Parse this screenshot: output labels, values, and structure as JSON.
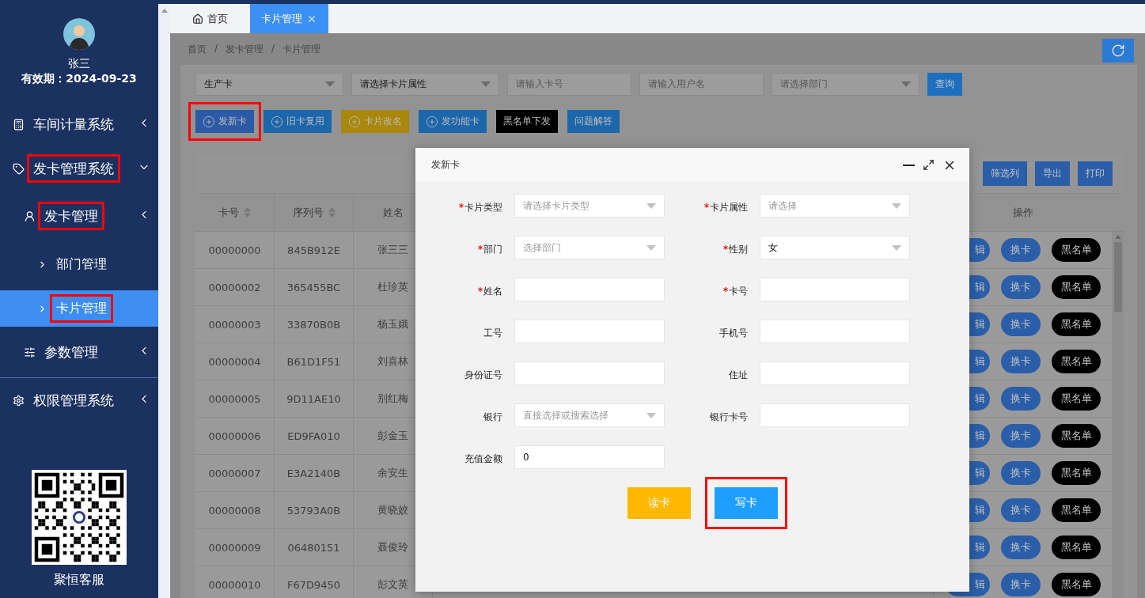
{
  "sidebar": {
    "user": {
      "name": "张三",
      "validity": "有效期：2024-09-23"
    },
    "menu": [
      {
        "label": "车间计量系统",
        "expanded": false,
        "selected": false,
        "highlighted": false
      },
      {
        "label": "发卡管理系统",
        "expanded": true,
        "selected": false,
        "highlighted": true,
        "children": [
          {
            "label": "发卡管理",
            "selected": false,
            "highlighted": true,
            "children": [
              {
                "label": "部门管理",
                "selected": false,
                "highlighted": false
              },
              {
                "label": "卡片管理",
                "selected": true,
                "highlighted": true
              }
            ]
          },
          {
            "label": "参数管理",
            "selected": false,
            "highlighted": false
          }
        ]
      },
      {
        "label": "权限管理系统",
        "expanded": false,
        "selected": false,
        "highlighted": false
      }
    ],
    "support": "聚恒客服"
  },
  "tabs": [
    {
      "label": "首页",
      "kind": "home",
      "selected": false
    },
    {
      "label": "卡片管理",
      "kind": "page",
      "selected": true
    }
  ],
  "breadcrumb": {
    "items": [
      "首页",
      "发卡管理",
      "卡片管理"
    ],
    "separator": "/"
  },
  "filters": [
    {
      "kind": "select",
      "value": "生产卡"
    },
    {
      "kind": "select",
      "value": "请选择卡片属性"
    },
    {
      "kind": "input",
      "placeholder": "请输入卡号"
    },
    {
      "kind": "input",
      "placeholder": "请输入用户名"
    },
    {
      "kind": "select",
      "placeholder": "请选择部门"
    }
  ],
  "search_button": "查询",
  "actions": [
    {
      "label": "发新卡",
      "kind": "plus",
      "color": "#2c5aa6",
      "highlighted": true
    },
    {
      "label": "旧卡复用",
      "kind": "plus",
      "color": "#1c66aa",
      "highlighted": false
    },
    {
      "label": "卡片改名",
      "kind": "plus",
      "color": "#a8870a",
      "highlighted": false
    },
    {
      "label": "发功能卡",
      "kind": "plus",
      "color": "#1c66aa",
      "highlighted": false
    },
    {
      "label": "黑名单下发",
      "kind": "plain",
      "color": "#000000",
      "highlighted": false
    },
    {
      "label": "问题解答",
      "kind": "plain",
      "color": "#1c66aa",
      "highlighted": false
    }
  ],
  "table": {
    "tools": [
      "筛选列",
      "导出",
      "打印"
    ],
    "columns": [
      {
        "label": "卡号",
        "sortable": true
      },
      {
        "label": "序列号",
        "sortable": true
      },
      {
        "label": "姓名",
        "sortable": false
      },
      {
        "label": "操作",
        "sortable": false
      }
    ],
    "rows": [
      {
        "cells": [
          "00000000",
          "845B912E",
          "张三三"
        ],
        "actions": [
          "辑",
          "换卡",
          "黑名单"
        ]
      },
      {
        "cells": [
          "00000002",
          "365455BC",
          "杜珍英"
        ],
        "actions": [
          "辑",
          "换卡",
          "黑名单"
        ]
      },
      {
        "cells": [
          "00000003",
          "33870B0B",
          "杨玉娥"
        ],
        "actions": [
          "辑",
          "换卡",
          "黑名单"
        ]
      },
      {
        "cells": [
          "00000004",
          "B61D1F51",
          "刘喜林"
        ],
        "actions": [
          "辑",
          "换卡",
          "黑名单"
        ]
      },
      {
        "cells": [
          "00000005",
          "9D11AE10",
          "别红梅"
        ],
        "actions": [
          "辑",
          "换卡",
          "黑名单"
        ]
      },
      {
        "cells": [
          "00000006",
          "ED9FA010",
          "彭金玉"
        ],
        "actions": [
          "辑",
          "换卡",
          "黑名单"
        ]
      },
      {
        "cells": [
          "00000007",
          "E3A2140B",
          "余安生"
        ],
        "actions": [
          "辑",
          "换卡",
          "黑名单"
        ]
      },
      {
        "cells": [
          "00000008",
          "53793A0B",
          "黄晓姣"
        ],
        "actions": [
          "辑",
          "换卡",
          "黑名单"
        ]
      },
      {
        "cells": [
          "00000009",
          "06480151",
          "聂俊玲"
        ],
        "actions": [
          "辑",
          "换卡",
          "黑名单"
        ]
      },
      {
        "cells": [
          "00000010",
          "F67D9450",
          "彭文英"
        ],
        "actions": [
          "辑",
          "换卡",
          "黑名单"
        ]
      }
    ]
  },
  "dialog": {
    "title": "发新卡",
    "fields": [
      {
        "label": "卡片类型",
        "required": true,
        "kind": "select",
        "placeholder": "请选择卡片类型"
      },
      {
        "label": "卡片属性",
        "required": true,
        "kind": "select",
        "placeholder": "请选择"
      },
      {
        "label": "部门",
        "required": true,
        "kind": "select",
        "placeholder": "选择部门"
      },
      {
        "label": "性别",
        "required": true,
        "kind": "select",
        "value": "女"
      },
      {
        "label": "姓名",
        "required": true,
        "kind": "input"
      },
      {
        "label": "卡号",
        "required": true,
        "kind": "input"
      },
      {
        "label": "工号",
        "required": false,
        "kind": "input"
      },
      {
        "label": "手机号",
        "required": false,
        "kind": "input"
      },
      {
        "label": "身份证号",
        "required": false,
        "kind": "input"
      },
      {
        "label": "住址",
        "required": false,
        "kind": "input"
      },
      {
        "label": "银行",
        "required": false,
        "kind": "select",
        "placeholder": "直接选择或搜索选择"
      },
      {
        "label": "银行卡号",
        "required": false,
        "kind": "input"
      },
      {
        "label": "充值金额",
        "required": false,
        "kind": "input",
        "value": "0"
      }
    ],
    "buttons": [
      {
        "label": "读卡",
        "color": "#ffb800",
        "highlighted": false
      },
      {
        "label": "写卡",
        "color": "#1e9fff",
        "highlighted": true
      }
    ]
  }
}
